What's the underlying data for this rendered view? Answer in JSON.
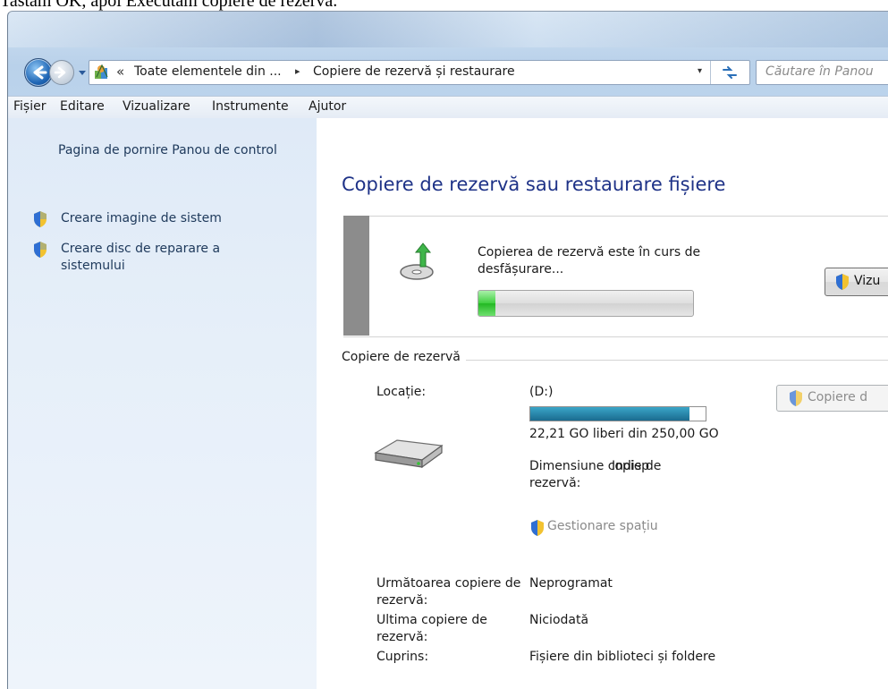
{
  "caption": "Tastam OK, apoi Executam copiere de rezervă.",
  "address": {
    "chevron": "«",
    "segment1": "Toate elementele din ...",
    "separator": "▸",
    "segment2": "Copiere de rezervă și restaurare",
    "dropdown": "▾"
  },
  "search": {
    "placeholder": "Căutare în Panou"
  },
  "menu": [
    "Fișier",
    "Editare",
    "Vizualizare",
    "Instrumente",
    "Ajutor"
  ],
  "left": {
    "home": "Pagina de pornire Panou de control",
    "tasks": [
      "Creare imagine de sistem",
      "Creare disc de reparare a sistemului"
    ]
  },
  "main": {
    "title": "Copiere de rezervă sau restaurare fișiere",
    "status_text": "Copierea de rezervă este în curs de desfășurare...",
    "progress_fraction": 0.08,
    "view_button": "Vizu",
    "backup_section": "Copiere de rezervă",
    "location_label": "Locație:",
    "location_value": "(D:)",
    "disk_used_fraction": 0.91,
    "disk_free_text": "22,21 GO liberi din 250,00 GO",
    "size_label": "Dimensiune copie de rezervă:",
    "size_value": "Indisp",
    "manage_space": "Gestionare spațiu",
    "backup_button": "Copiere d",
    "next_label": "Următoarea copiere de rezervă:",
    "next_value": "Neprogramat",
    "last_label": "Ultima copiere de rezervă:",
    "last_value": "Niciodată",
    "contents_label": "Cuprins:",
    "contents_value": "Fișiere din biblioteci și foldere"
  },
  "colors": {
    "title_blue": "#1e3287",
    "link_blue": "#1e395b",
    "progress_green": "#3fcf3f",
    "disk_teal": "#1b6b8f"
  }
}
